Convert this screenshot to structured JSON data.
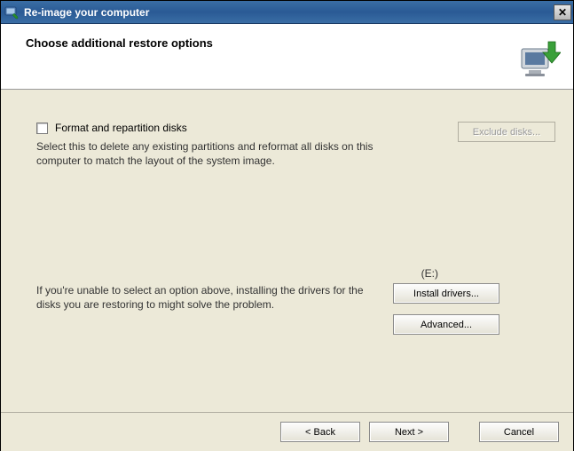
{
  "window": {
    "title": "Re-image your computer"
  },
  "header": {
    "title": "Choose additional restore options"
  },
  "options": {
    "format": {
      "label": "Format and repartition disks",
      "description": "Select this to delete any existing partitions and reformat all disks on this computer to match the layout of the system image.",
      "exclude_button": "Exclude disks..."
    },
    "drive_letter": "(E:)",
    "drivers": {
      "description": "If you're unable to select an option above, installing the drivers for the disks you are restoring to might solve the problem.",
      "install_button": "Install drivers...",
      "advanced_button": "Advanced..."
    }
  },
  "footer": {
    "back": "< Back",
    "next": "Next >",
    "cancel": "Cancel"
  }
}
